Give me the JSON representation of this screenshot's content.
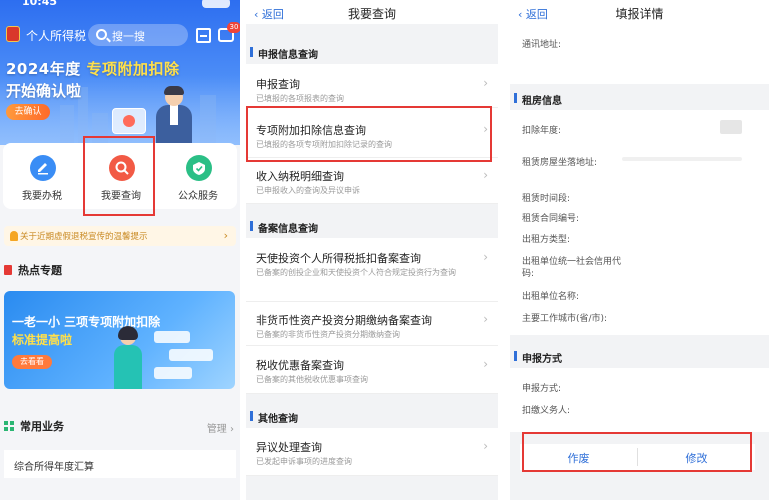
{
  "panel1": {
    "status_time": "10:45",
    "app_name": "个人所得税",
    "search_placeholder": "搜一搜",
    "msg_badge": "30",
    "banner_title_a": "2024年度",
    "banner_title_b": "专项附加扣除",
    "banner_sub": "开始确认啦",
    "banner_button": "去确认",
    "quick": [
      {
        "label": "我要办税",
        "icon": "pen-icon"
      },
      {
        "label": "我要查询",
        "icon": "search-icon"
      },
      {
        "label": "公众服务",
        "icon": "service-icon"
      }
    ],
    "notice": "关于近期虚假退税宣传的温馨提示",
    "hot_title": "热点专题",
    "promo_line1": "一老一小 三项专项附加扣除",
    "promo_line2": "标准提高啦",
    "promo_button": "去看看",
    "common_title": "常用业务",
    "manage": "管理",
    "common_item": "综合所得年度汇算"
  },
  "panel2": {
    "back": "返回",
    "title": "我要查询",
    "groups": [
      {
        "title": "申报信息查询",
        "rows": [
          {
            "title": "申报查询",
            "sub": "已填报的各项报表的查询"
          },
          {
            "title": "专项附加扣除信息查询",
            "sub": "已填报的各项专项附加扣除记录的查询"
          },
          {
            "title": "收入纳税明细查询",
            "sub": "已申报收入的查询及异议申诉"
          }
        ]
      },
      {
        "title": "备案信息查询",
        "rows": [
          {
            "title": "天使投资个人所得税抵扣备案查询",
            "sub": "已备案的创投企业和天使投资个人符合规定投资行为查询"
          },
          {
            "title": "非货币性资产投资分期缴纳备案查询",
            "sub": "已备案的非货币性资产投资分期缴纳查询"
          },
          {
            "title": "税收优惠备案查询",
            "sub": "已备案的其他税收优惠事项查询"
          }
        ]
      },
      {
        "title": "其他查询",
        "rows": [
          {
            "title": "异议处理查询",
            "sub": "已发起申诉事项的进度查询"
          }
        ]
      }
    ]
  },
  "panel3": {
    "back": "返回",
    "title": "填报详情",
    "address_label": "通讯地址:",
    "rent_group": "租房信息",
    "rent_fields": [
      "扣除年度:",
      "租赁房屋坐落地址:",
      "租赁时间段:",
      "租赁合同编号:",
      "出租方类型:",
      "出租单位统一社会信用代码:",
      "出租单位名称:",
      "主要工作城市(省/市):"
    ],
    "declare_group": "申报方式",
    "declare_fields": [
      "申报方式:",
      "扣缴义务人:"
    ],
    "btn_void": "作废",
    "btn_edit": "修改"
  }
}
